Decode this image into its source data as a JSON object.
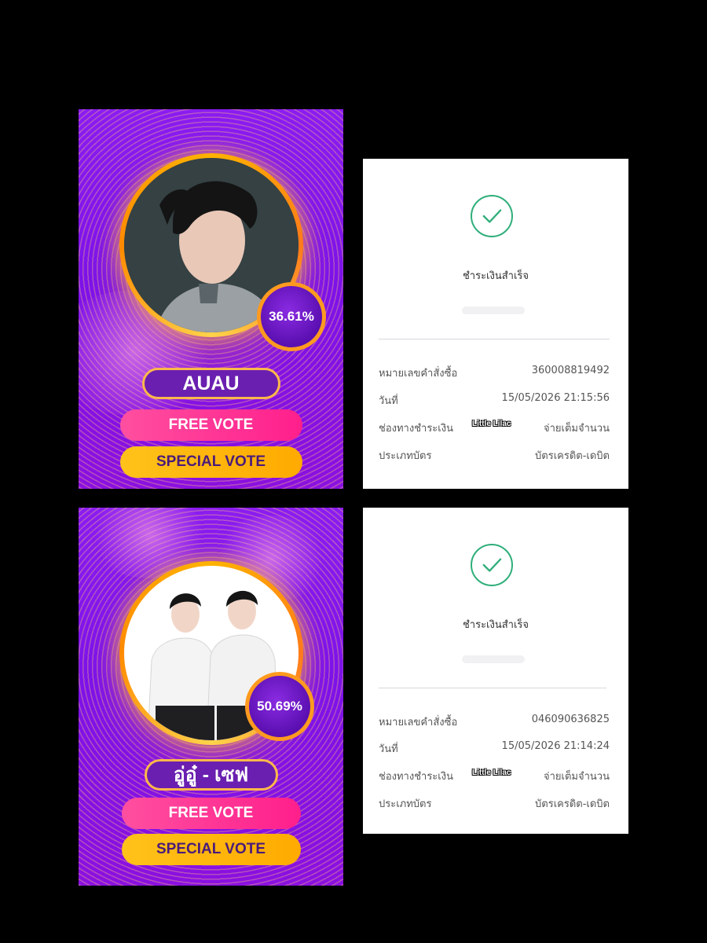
{
  "vote_cards": [
    {
      "percent": "36.61%",
      "name": "AUAU",
      "free_vote_label": "FREE VOTE",
      "special_vote_label": "SPECIAL VOTE"
    },
    {
      "percent": "50.69%",
      "name": "อู่อู๋ - เซฟ",
      "free_vote_label": "FREE VOTE",
      "special_vote_label": "SPECIAL VOTE"
    }
  ],
  "receipts": [
    {
      "status": "ชำระเงินสำเร็จ",
      "order_number_label": "หมายเลขคำสั่งซื้อ",
      "order_number": "360008819492",
      "date_label": "วันที่",
      "date": "15/05/2026 21:15:56",
      "payment_channel_label": "ช่องทางชำระเงิน",
      "payment_channel": "จ่ายเต็มจำนวน",
      "card_type_label": "ประเภทบัตร",
      "card_type": "บัตรเครดิต-เดบิต"
    },
    {
      "status": "ชำระเงินสำเร็จ",
      "order_number_label": "หมายเลขคำสั่งซื้อ",
      "order_number": "046090636825",
      "date_label": "วันที่",
      "date": "15/05/2026 21:14:24",
      "payment_channel_label": "ช่องทางชำระเงิน",
      "payment_channel": "จ่ายเต็มจำนวน",
      "card_type_label": "ประเภทบัตร",
      "card_type": "บัตรเครดิต-เดบิต"
    }
  ],
  "watermark": "Little Lilac",
  "colors": {
    "card_purple": "#8a1cf0",
    "ring_orange": "#ffb300",
    "free_vote_pink": "#ff2f92",
    "special_vote_yellow": "#ffb70f",
    "success_green": "#2fae7a"
  }
}
